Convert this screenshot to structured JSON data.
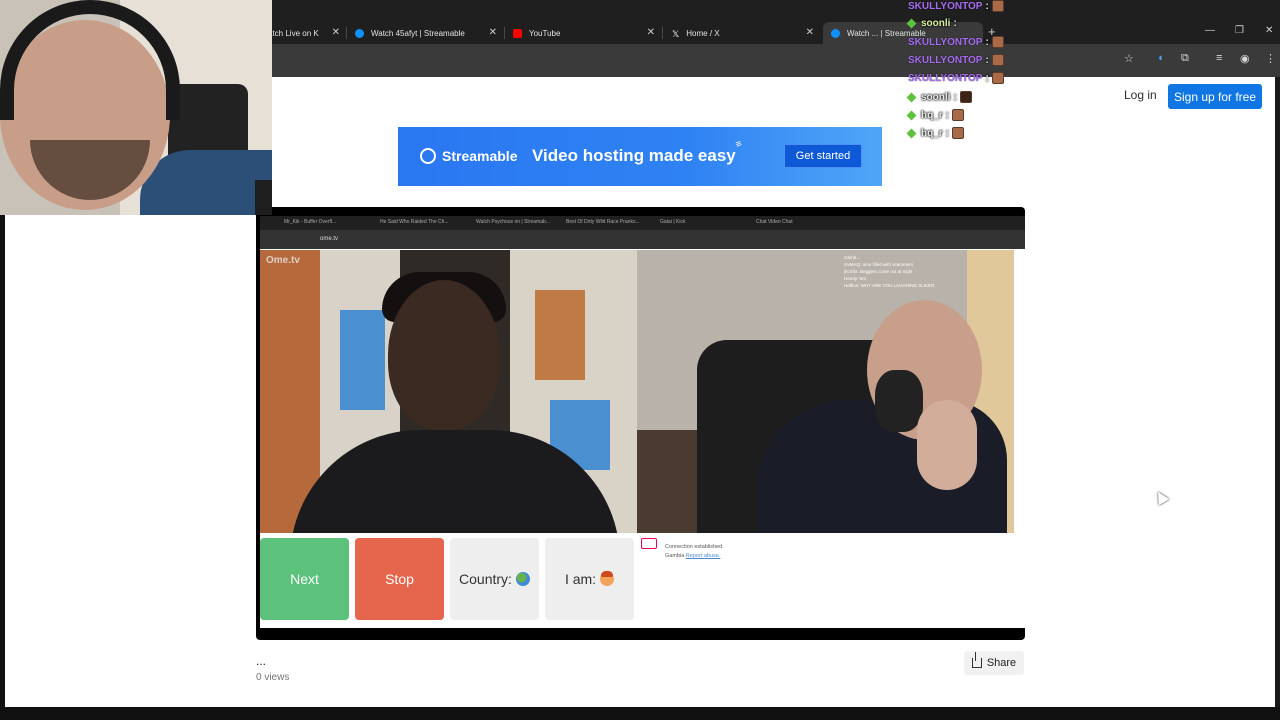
{
  "browser": {
    "tabs": [
      {
        "title": "atch Live on K",
        "favicon_color": "#53fc18"
      },
      {
        "title": "Watch 45afyt | Streamable",
        "favicon_color": "#0f90fa"
      },
      {
        "title": "YouTube",
        "favicon_color": "#ff0000"
      },
      {
        "title": "Home / X",
        "favicon_color": "#ffffff"
      },
      {
        "title": "Watch ... | Streamable",
        "favicon_color": "#0f90fa"
      }
    ]
  },
  "header": {
    "login_label": "Log in",
    "signup_label": "Sign up for free"
  },
  "banner": {
    "logo_text": "Streamable",
    "tagline": "Video hosting made easy",
    "cta_label": "Get started"
  },
  "player": {
    "logo_text": "Ome.tv",
    "url_text": "ome.tv",
    "inner_tabs": [
      "Mr_Kik - Buffer Overfl...",
      "He Said Who Raided The Ch...",
      "Watch Psychous on | Streamab...",
      "Best Of Dirty Wild Race Pranks...",
      "Gatai | Kick",
      "Chat Video Chat"
    ],
    "inner_chat": [
      "Gamb...",
      "jhcmbr: Beggers come out at night",
      "Handy: bro",
      "Haffion: WHY ARE YOU LAUGHING SLIKER",
      "cIvMAQ: ome filled with scammers"
    ],
    "controls": {
      "next": "Next",
      "stop": "Stop",
      "country": "Country:",
      "iam": "I am:"
    },
    "connection": {
      "status": "Connection established.",
      "country": "Gambia",
      "report": "Report abuse."
    }
  },
  "video_meta": {
    "title": "...",
    "views": "0 views",
    "share_label": "Share"
  },
  "chat": [
    {
      "user": "SKULLYONTOP",
      "style": "purple",
      "badge": false
    },
    {
      "user": "soonli",
      "style": "green",
      "badge": true
    },
    {
      "user": "SKULLYONTOP",
      "style": "purple",
      "badge": false
    },
    {
      "user": "SKULLYONTOP",
      "style": "purple",
      "badge": false
    },
    {
      "user": "SKULLYONTOP",
      "style": "purple",
      "badge": false
    },
    {
      "user": "soonli",
      "style": "grey",
      "badge": true
    },
    {
      "user": "hq_r",
      "style": "grey",
      "badge": true
    },
    {
      "user": "hq_r",
      "style": "grey",
      "badge": true
    }
  ],
  "colors": {
    "accent_blue": "#0f76e3",
    "next_green": "#5cc17b",
    "stop_red": "#e5654d"
  }
}
